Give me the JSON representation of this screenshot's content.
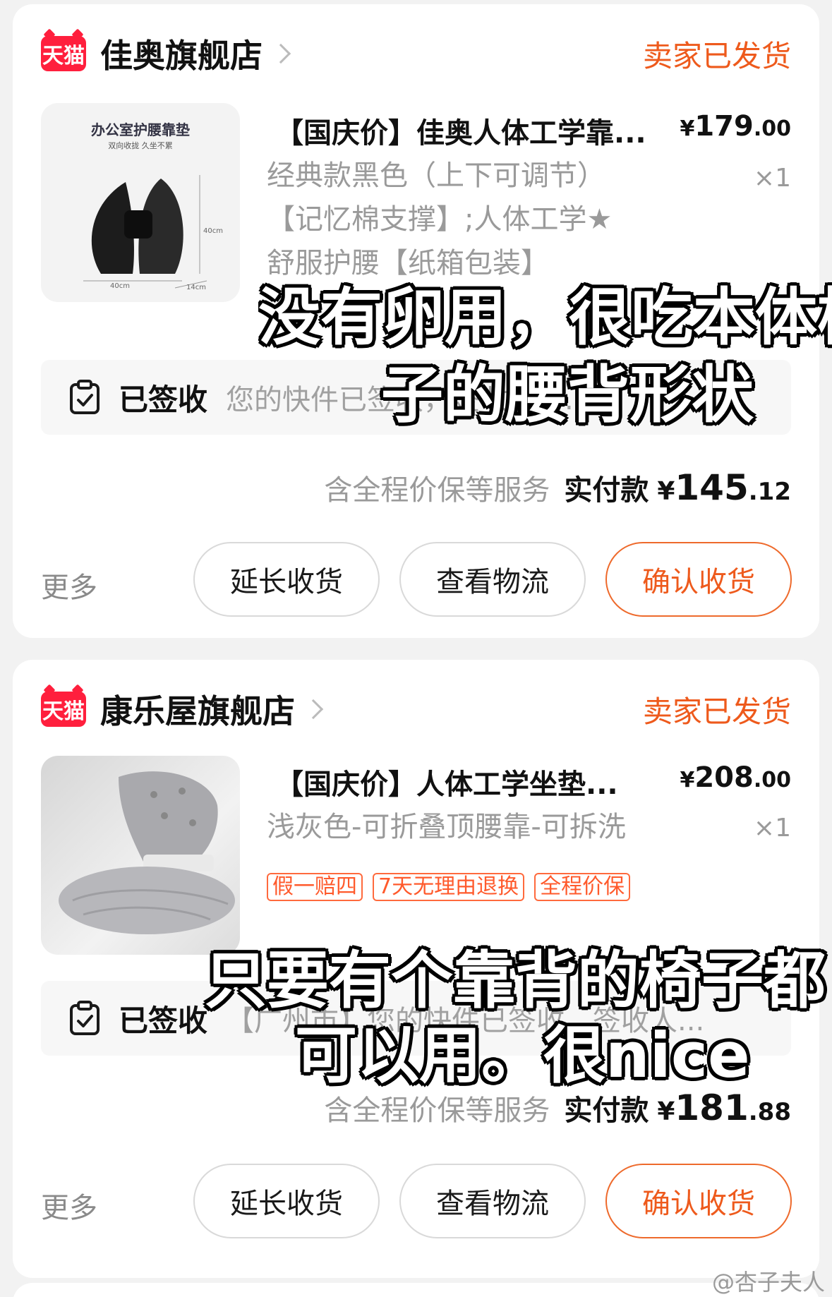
{
  "orders": [
    {
      "store_badge": "天猫",
      "store_name": "佳奥旗舰店",
      "status": "卖家已发货",
      "product_title": "【国庆价】佳奥人体工学靠...",
      "price_cur": "¥",
      "price_int": "179",
      "price_dec": ".00",
      "spec_line1": "经典款黑色（上下可调节）",
      "spec_line2": "【记忆棉支撑】;人体工学★",
      "spec_line3": "舒服护腰【纸箱包装】",
      "qty": "×1",
      "thumb_title": "办公室护腰靠垫",
      "thumb_sub": "双向收拢 久坐不累",
      "thumb_dim1": "40cm",
      "thumb_dim2": "40cm",
      "thumb_dim3": "14cm",
      "track_status": "已签收",
      "track_msg": "您的快件已签收，签收人有...",
      "service": "含全程价保等服务",
      "paid_label": "实付款",
      "paid_cur": "¥",
      "paid_int": "145",
      "paid_dec": ".12",
      "more": "更多",
      "btn_extend": "延长收货",
      "btn_logistics": "查看物流",
      "btn_confirm": "确认收货"
    },
    {
      "store_badge": "天猫",
      "store_name": "康乐屋旗舰店",
      "status": "卖家已发货",
      "product_title": "【国庆价】人体工学坐垫...",
      "price_cur": "¥",
      "price_int": "208",
      "price_dec": ".00",
      "spec_line1": "浅灰色-可折叠顶腰靠-可拆洗",
      "qty": "×1",
      "tags": [
        "假一赔四",
        "7天无理由退换",
        "全程价保"
      ],
      "track_status": "已签收",
      "track_msg": "【广州市】您的快件已签收，签收人...",
      "service": "含全程价保等服务",
      "paid_label": "实付款",
      "paid_cur": "¥",
      "paid_int": "181",
      "paid_dec": ".88",
      "more": "更多",
      "btn_extend": "延长收货",
      "btn_logistics": "查看物流",
      "btn_confirm": "确认收货"
    }
  ],
  "captions": {
    "caption1_line1": "没有卵用，很吃本体椅",
    "caption1_line2": "子的腰背形状",
    "caption2_line1": "只要有个靠背的椅子都",
    "caption2_line2": "可以用。很nice"
  },
  "watermark": "@杏子夫人",
  "colors": {
    "accent": "#ee5a1c",
    "tmall_red": "#ff1f3d",
    "tag": "#ff5a2c"
  }
}
